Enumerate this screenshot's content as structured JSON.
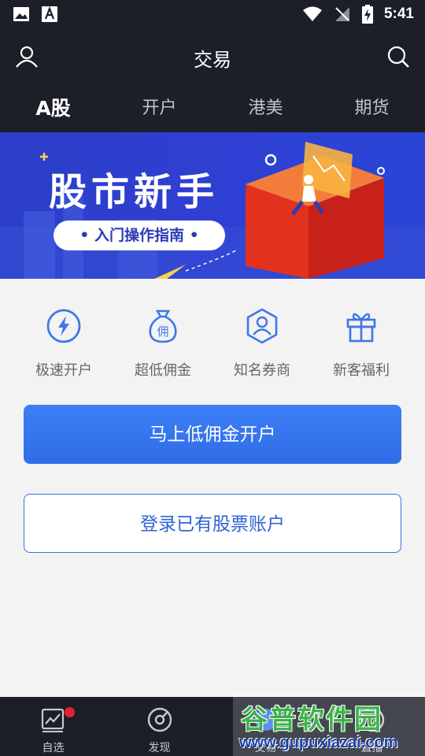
{
  "status_bar": {
    "time": "5:41"
  },
  "header": {
    "title": "交易"
  },
  "tabs": [
    {
      "label": "A股",
      "active": true
    },
    {
      "label": "开户",
      "active": false
    },
    {
      "label": "港美",
      "active": false
    },
    {
      "label": "期货",
      "active": false
    }
  ],
  "banner": {
    "title": "股市新手",
    "subtitle": "• 入门操作指南 •"
  },
  "features": [
    {
      "label": "极速开户",
      "icon": "lightning-icon"
    },
    {
      "label": "超低佣金",
      "icon": "money-bag-icon"
    },
    {
      "label": "知名券商",
      "icon": "user-shield-icon"
    },
    {
      "label": "新客福利",
      "icon": "gift-icon"
    }
  ],
  "buttons": {
    "primary": "马上低佣金开户",
    "secondary": "登录已有股票账户"
  },
  "bottom_nav": [
    {
      "label": "自选",
      "icon": "chart-icon",
      "badge": true
    },
    {
      "label": "发现",
      "icon": "discover-icon",
      "badge": false
    },
    {
      "label": "交易",
      "icon": "trade-icon",
      "badge": false
    },
    {
      "label": "直播",
      "icon": "live-icon",
      "badge": false
    }
  ],
  "watermark": {
    "main": "谷普软件园",
    "url": "www.gupuxiazai.com"
  },
  "colors": {
    "header_bg": "#1c1f28",
    "primary_blue": "#2f6de8",
    "badge_red": "#e8212c"
  }
}
